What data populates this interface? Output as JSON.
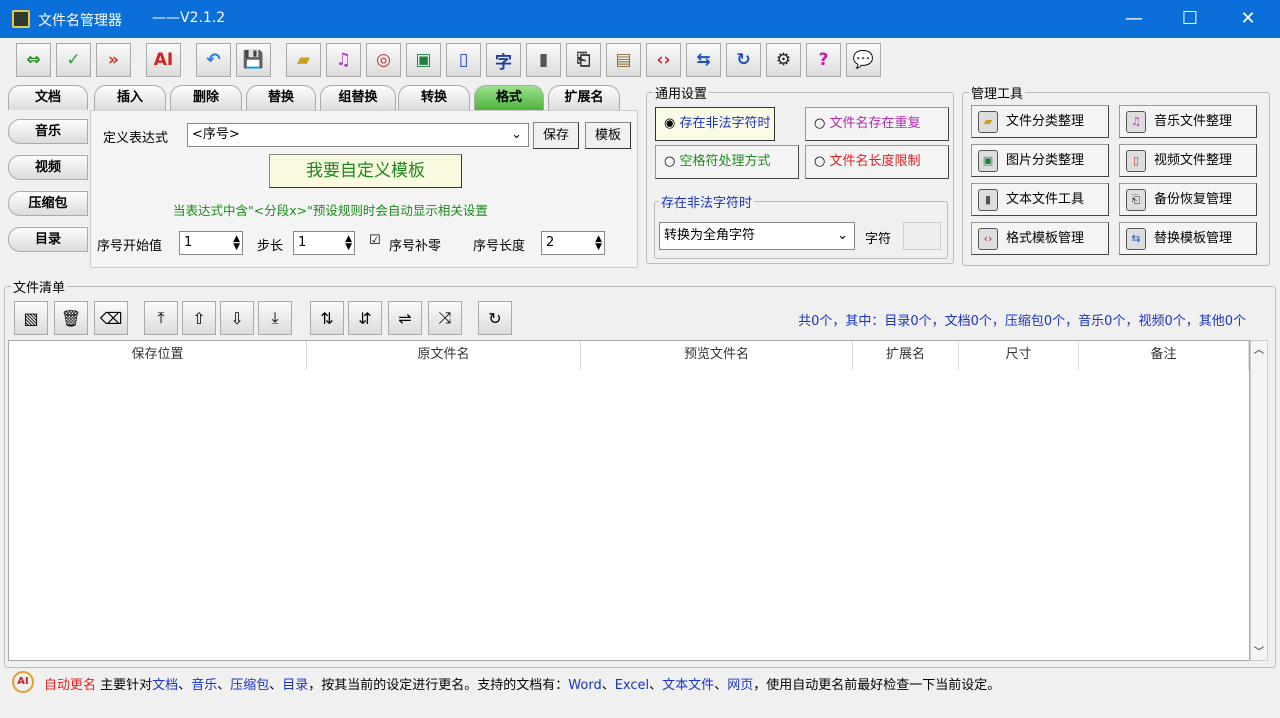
{
  "window": {
    "title": "文件名管理器",
    "version": "——V2.1.2",
    "minimize": "—",
    "maximize": "☐",
    "close": "✕"
  },
  "toolbar": [
    {
      "name": "convert",
      "glyph": "⇔",
      "color": "#2a8a2a"
    },
    {
      "name": "apply",
      "glyph": "✓",
      "color": "#2aa52a"
    },
    {
      "name": "forward",
      "glyph": "»",
      "color": "#c0392b"
    },
    {
      "name": "ai-rename",
      "glyph": "AI",
      "color": "#d02020"
    },
    {
      "name": "undo",
      "glyph": "↶",
      "color": "#2a7ad6"
    },
    {
      "name": "save-time",
      "glyph": "💾",
      "color": "#333"
    },
    {
      "name": "folder",
      "glyph": "▰",
      "color": "#c9a020"
    },
    {
      "name": "music",
      "glyph": "♫",
      "color": "#b030b0"
    },
    {
      "name": "video",
      "glyph": "◎",
      "color": "#d03030"
    },
    {
      "name": "image",
      "glyph": "▣",
      "color": "#208040"
    },
    {
      "name": "document",
      "glyph": "▯",
      "color": "#2040c0"
    },
    {
      "name": "text",
      "glyph": "字",
      "color": "#2040a0"
    },
    {
      "name": "file",
      "glyph": "▮",
      "color": "#555"
    },
    {
      "name": "backup",
      "glyph": "⎗",
      "color": "#333"
    },
    {
      "name": "notebook",
      "glyph": "▤",
      "color": "#8a6a30"
    },
    {
      "name": "format-template",
      "glyph": "‹›",
      "color": "#c03030"
    },
    {
      "name": "replace-template",
      "glyph": "⇆",
      "color": "#2050c0"
    },
    {
      "name": "refresh-file",
      "glyph": "↻",
      "color": "#2050c0"
    },
    {
      "name": "settings",
      "glyph": "⚙",
      "color": "#222"
    },
    {
      "name": "help",
      "glyph": "?",
      "color": "#c020a0"
    },
    {
      "name": "chat",
      "glyph": "💬",
      "color": "#333"
    }
  ],
  "tabs": [
    "文档",
    "插入",
    "删除",
    "替换",
    "组替换",
    "转换",
    "格式",
    "扩展名"
  ],
  "active_tab": "格式",
  "side_tabs": [
    "音乐",
    "视频",
    "压缩包",
    "目录"
  ],
  "format": {
    "expr_label": "定义表达式",
    "expr_value": "<序号>",
    "save": "保存",
    "template": "模板",
    "custom_button": "我要自定义模板",
    "hint": "当表达式中含\"<分段x>\"预设规则时会自动显示相关设置",
    "start_label": "序号开始值",
    "start_value": "1",
    "step_label": "步长",
    "step_value": "1",
    "pad_label": "序号补零",
    "pad_checked": true,
    "len_label": "序号长度",
    "len_value": "2"
  },
  "general": {
    "title": "通用设置",
    "options": [
      {
        "label": "存在非法字符时",
        "color": "#1a33c4",
        "selected": true
      },
      {
        "label": "文件名存在重复",
        "color": "#b02ab0",
        "selected": false
      },
      {
        "label": "空格符处理方式",
        "color": "#208a20",
        "selected": false
      },
      {
        "label": "文件名长度限制",
        "color": "#e02020",
        "selected": false
      }
    ],
    "sub_title": "存在非法字符时",
    "select_value": "转换为全角字符",
    "char_label": "字符",
    "char_value": ""
  },
  "tools": {
    "title": "管理工具",
    "items": [
      {
        "label": "文件分类整理",
        "glyph": "▰",
        "color": "#c9a020"
      },
      {
        "label": "音乐文件整理",
        "glyph": "♫",
        "color": "#b030b0"
      },
      {
        "label": "图片分类整理",
        "glyph": "▣",
        "color": "#208040"
      },
      {
        "label": "视频文件整理",
        "glyph": "▯",
        "color": "#d03030"
      },
      {
        "label": "文本文件工具",
        "glyph": "▮",
        "color": "#555"
      },
      {
        "label": "备份恢复管理",
        "glyph": "⎗",
        "color": "#333"
      },
      {
        "label": "格式模板管理",
        "glyph": "‹›",
        "color": "#c03030"
      },
      {
        "label": "替换模板管理",
        "glyph": "⇆",
        "color": "#2050c0"
      }
    ]
  },
  "filelist": {
    "title": "文件清单",
    "toolbar": [
      {
        "name": "add-files",
        "glyph": "▧"
      },
      {
        "name": "delete",
        "glyph": "🗑"
      },
      {
        "name": "clear",
        "glyph": "⌫"
      },
      {
        "name": "move-top",
        "glyph": "⤒"
      },
      {
        "name": "move-up",
        "glyph": "⇧"
      },
      {
        "name": "move-down",
        "glyph": "⇩"
      },
      {
        "name": "move-bottom",
        "glyph": "⤓"
      },
      {
        "name": "sort-asc",
        "glyph": "⇅"
      },
      {
        "name": "sort-desc",
        "glyph": "⇵"
      },
      {
        "name": "reverse",
        "glyph": "⇌"
      },
      {
        "name": "shuffle",
        "glyph": "⤨"
      },
      {
        "name": "refresh",
        "glyph": "↻"
      }
    ],
    "summary": "共0个，其中：目录0个，文档0个，压缩包0个，音乐0个，视频0个，其他0个",
    "columns": [
      "保存位置",
      "原文件名",
      "预览文件名",
      "扩展名",
      "尺寸",
      "备注"
    ],
    "rows": []
  },
  "status": {
    "parts": [
      {
        "t": "自动更名",
        "c": "#e02020"
      },
      {
        "t": " 主要针对",
        "c": "#000"
      },
      {
        "t": "文档",
        "c": "#1a33c4"
      },
      {
        "t": "、",
        "c": "#000"
      },
      {
        "t": "音乐",
        "c": "#1a33c4"
      },
      {
        "t": "、",
        "c": "#000"
      },
      {
        "t": "压缩包",
        "c": "#1a33c4"
      },
      {
        "t": "、",
        "c": "#000"
      },
      {
        "t": "目录",
        "c": "#1a33c4"
      },
      {
        "t": "，按其当前的设定进行更名。支持的文档有：",
        "c": "#000"
      },
      {
        "t": "Word",
        "c": "#1a33c4"
      },
      {
        "t": "、",
        "c": "#000"
      },
      {
        "t": "Excel",
        "c": "#1a33c4"
      },
      {
        "t": "、",
        "c": "#000"
      },
      {
        "t": "文本文件",
        "c": "#1a33c4"
      },
      {
        "t": "、",
        "c": "#000"
      },
      {
        "t": "网页",
        "c": "#1a33c4"
      },
      {
        "t": "，使用自动更名前最好检查一下当前设定。",
        "c": "#000"
      }
    ]
  }
}
